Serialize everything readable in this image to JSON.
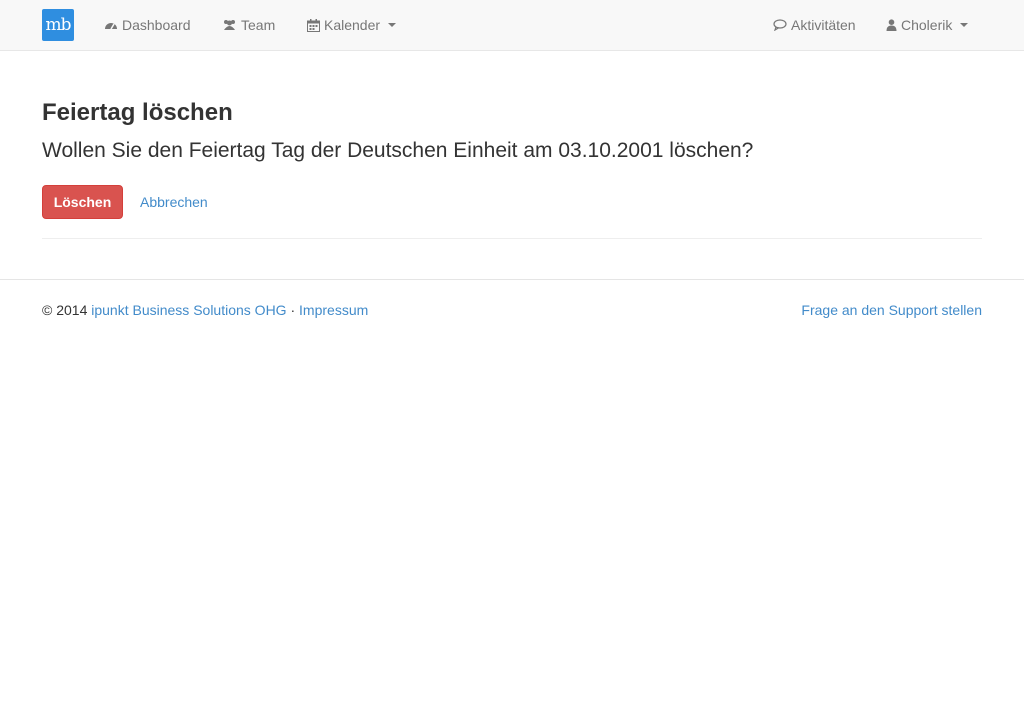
{
  "nav": {
    "logo_text": "mb",
    "dashboard_label": "Dashboard",
    "team_label": "Team",
    "kalender_label": "Kalender",
    "aktivitaeten_label": "Aktivitäten",
    "user_label": "Cholerik"
  },
  "page": {
    "title": "Feiertag löschen",
    "question": "Wollen Sie den Feiertag Tag der Deutschen Einheit am 03.10.2001 löschen?",
    "delete_label": "Löschen",
    "cancel_label": "Abbrechen"
  },
  "footer": {
    "copyright": "© 2014",
    "company_link": "ipunkt Business Solutions OHG",
    "separator": "·",
    "impressum_link": "Impressum",
    "support_link": "Frage an den Support stellen"
  },
  "colors": {
    "brand": "#2f8ee0",
    "danger": "#d9534f",
    "link": "#428bca"
  }
}
